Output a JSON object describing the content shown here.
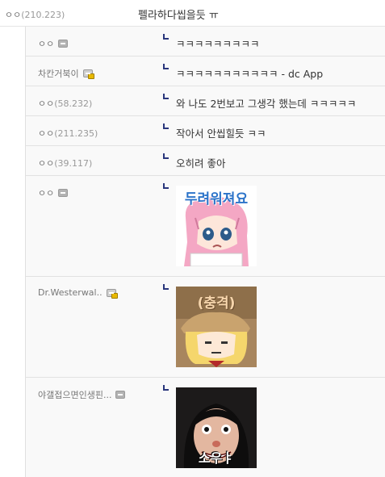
{
  "parent_comment": {
    "nick": "ㅇㅇ",
    "ip": "(210.223)",
    "text": "펠라하다씹을듯 ㅠ"
  },
  "replies": [
    {
      "nick": "ㅇㅇ",
      "ip": "",
      "badge": "mobile-icon",
      "text": "ㅋㅋㅋㅋㅋㅋㅋㅋㅋ"
    },
    {
      "nick": "차칸거북이",
      "ip": "",
      "badge": "fixed-nick-icon",
      "text": "ㅋㅋㅋㅋㅋㅋㅋㅋㅋㅋㅋ - dc App"
    },
    {
      "nick": "ㅇㅇ",
      "ip": "(58.232)",
      "badge": "",
      "text": "와 나도 2번보고 그생각 했는데 ㅋㅋㅋㅋㅋ"
    },
    {
      "nick": "ㅇㅇ",
      "ip": "(211.235)",
      "badge": "",
      "text": "작아서 안씹힐듯 ㅋㅋ"
    },
    {
      "nick": "ㅇㅇ",
      "ip": "(39.117)",
      "badge": "",
      "text": "오히려 좋아"
    },
    {
      "nick": "ㅇㅇ",
      "ip": "",
      "badge": "mobile-icon",
      "sticker_caption": "두려워져요"
    },
    {
      "nick": "Dr.Westerwal..",
      "ip": "",
      "badge": "fixed-nick-icon",
      "sticker_caption": "(충격)"
    },
    {
      "nick": "야갤접으면인생핀...",
      "ip": "",
      "badge": "mobile-icon",
      "sticker_caption": "소우ㅑ"
    }
  ]
}
